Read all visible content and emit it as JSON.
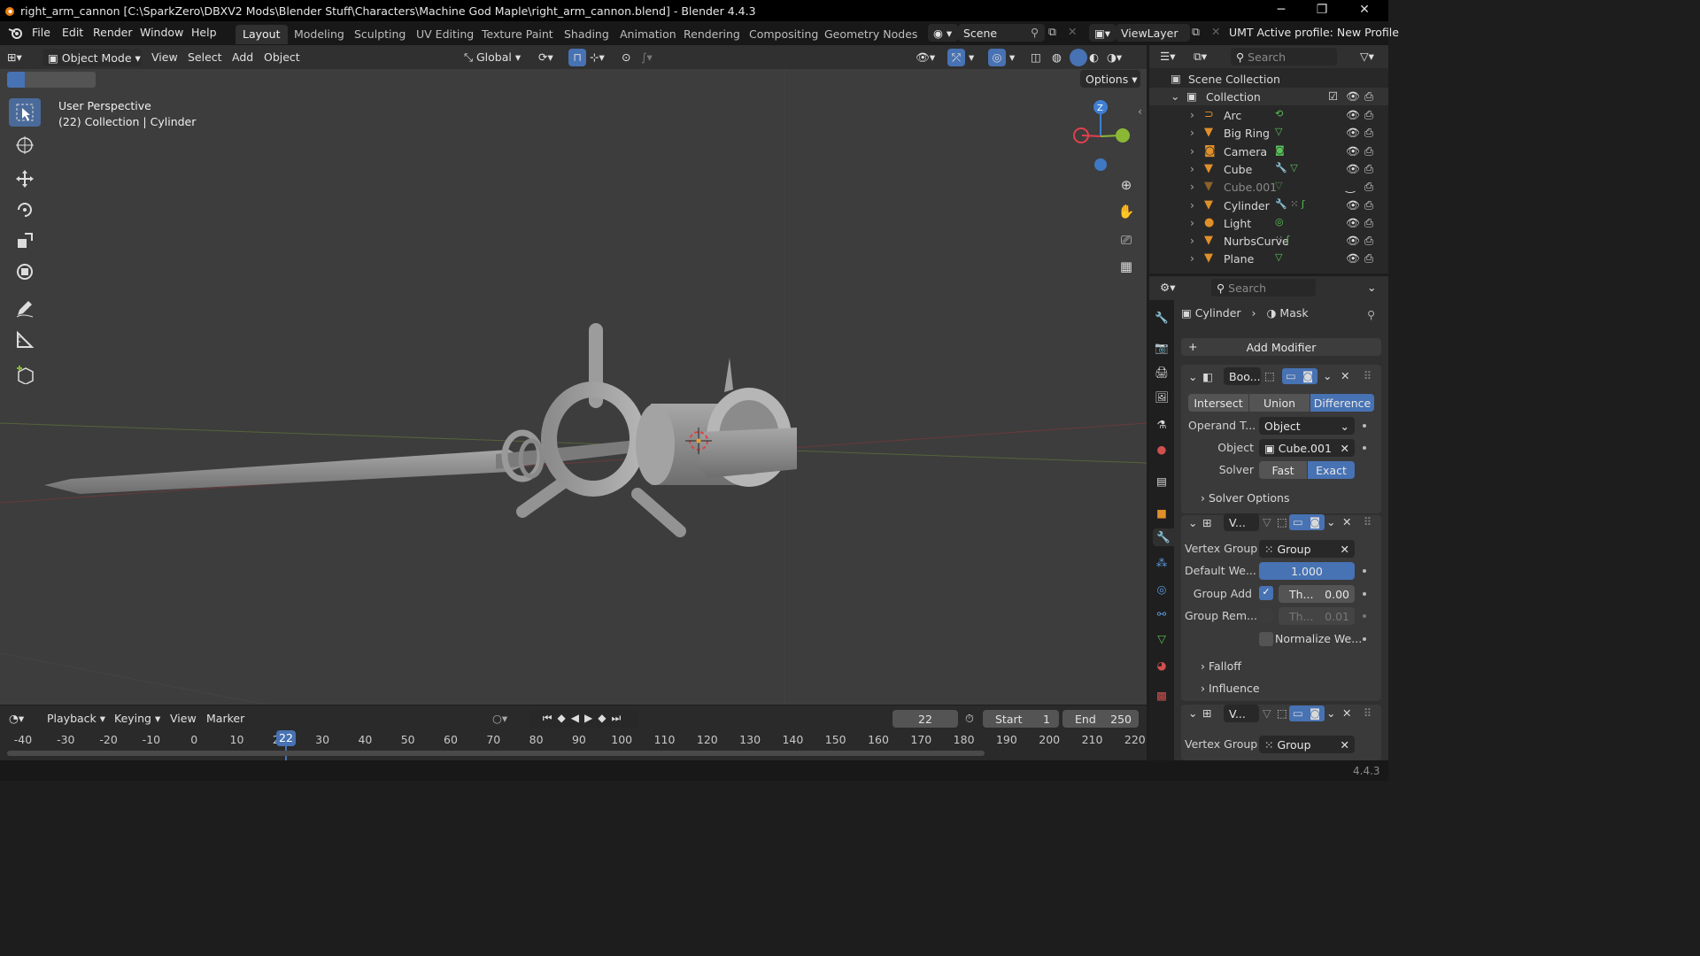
{
  "window": {
    "title": "right_arm_cannon [C:\\SparkZero\\DBXV2 Mods\\Blender Stuff\\Characters\\Machine God Maple\\right_arm_cannon.blend] - Blender 4.4.3",
    "minimize": "─",
    "maximize": "❐",
    "close": "✕"
  },
  "menu": [
    "File",
    "Edit",
    "Render",
    "Window",
    "Help"
  ],
  "workspaces": [
    "Layout",
    "Modeling",
    "Sculpting",
    "UV Editing",
    "Texture Paint",
    "Shading",
    "Animation",
    "Rendering",
    "Compositing",
    "Geometry Nodes"
  ],
  "active_workspace": "Layout",
  "scene": {
    "name": "Scene",
    "view_layer": "ViewLayer",
    "umt_profile": "UMT Active profile: New Profile"
  },
  "viewport_header": {
    "mode": "Object Mode",
    "menus": [
      "View",
      "Select",
      "Add",
      "Object"
    ],
    "orientation": "Global",
    "options": "Options"
  },
  "viewport": {
    "perspective": "User Perspective",
    "context": "(22) Collection | Cylinder",
    "gizmo_axis": "Z"
  },
  "timeline": {
    "menus": [
      "Playback",
      "Keying",
      "View",
      "Marker"
    ],
    "current_frame": "22",
    "start_label": "Start",
    "start": "1",
    "end_label": "End",
    "end": "250",
    "ticks": [
      "-40",
      "-30",
      "-20",
      "-10",
      "0",
      "10",
      "20",
      "30",
      "40",
      "50",
      "60",
      "70",
      "80",
      "90",
      "100",
      "110",
      "120",
      "130",
      "140",
      "150",
      "160",
      "170",
      "180",
      "190",
      "200",
      "210",
      "220"
    ],
    "playhead": "22"
  },
  "status": {
    "version": "4.4.3"
  },
  "outliner": {
    "search_placeholder": "Search",
    "scene_collection": "Scene Collection",
    "collection": "Collection",
    "items": [
      {
        "name": "Arc",
        "type": "curve",
        "dim": false
      },
      {
        "name": "Big Ring",
        "type": "mesh",
        "dim": false
      },
      {
        "name": "Camera",
        "type": "camera",
        "dim": false
      },
      {
        "name": "Cube",
        "type": "mesh",
        "dim": false
      },
      {
        "name": "Cube.001",
        "type": "mesh",
        "dim": true
      },
      {
        "name": "Cylinder",
        "type": "mesh",
        "dim": false
      },
      {
        "name": "Light",
        "type": "light",
        "dim": false
      },
      {
        "name": "NurbsCurve",
        "type": "mesh",
        "dim": false
      },
      {
        "name": "Plane",
        "type": "mesh",
        "dim": false
      }
    ]
  },
  "properties": {
    "search_placeholder": "Search",
    "breadcrumb_object": "Cylinder",
    "breadcrumb_modifier": "Mask",
    "add_modifier": "Add Modifier",
    "boolean": {
      "name": "Boo...",
      "ops": [
        "Intersect",
        "Union",
        "Difference"
      ],
      "active_op": "Difference",
      "operand_label": "Operand T...",
      "operand_value": "Object",
      "object_label": "Object",
      "object_value": "Cube.001",
      "solver_label": "Solver",
      "solver_opts": [
        "Fast",
        "Exact"
      ],
      "active_solver": "Exact",
      "solver_options": "Solver Options"
    },
    "vw1": {
      "name": "V...",
      "vgroup_label": "Vertex Group",
      "vgroup_value": "Group",
      "default_weight_label": "Default We...",
      "default_weight": "1.000",
      "group_add_label": "Group Add",
      "group_add_checked": true,
      "group_add_thresh": "Th...",
      "group_add_value": "0.00",
      "group_rem_label": "Group Rem...",
      "group_rem_thresh": "Th...",
      "group_rem_value": "0.01",
      "normalize": "Normalize We...",
      "falloff": "Falloff",
      "influence": "Influence"
    },
    "vw2": {
      "name": "V...",
      "vgroup_label": "Vertex Group",
      "vgroup_value": "Group"
    }
  },
  "colors": {
    "accent": "#4772b3",
    "x_axis": "#e0414d",
    "y_axis": "#8ab835",
    "z_axis": "#3f7fd3",
    "object": "#d08a3a"
  }
}
